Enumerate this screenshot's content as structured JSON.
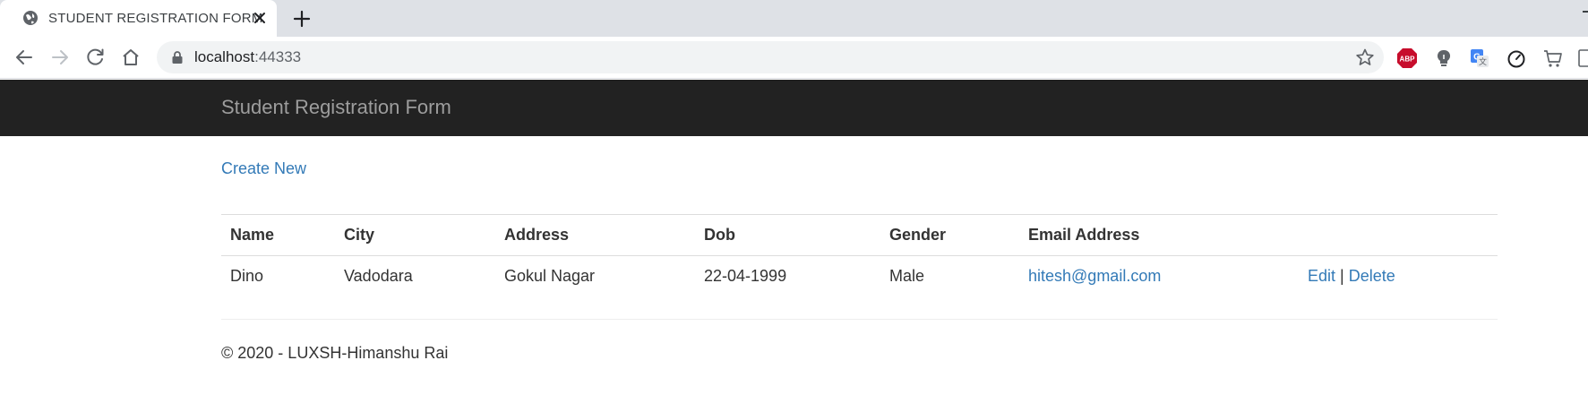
{
  "browser": {
    "tab_title": "STUDENT REGISTRATION FORM",
    "url_host": "localhost",
    "url_port": ":44333",
    "extensions": [
      "abp-icon",
      "lightbulb-icon",
      "translate-icon",
      "speedometer-icon",
      "cart-icon",
      "page-icon"
    ]
  },
  "navbar": {
    "brand": "Student Registration Form"
  },
  "actions": {
    "create_new": "Create New"
  },
  "table": {
    "headers": [
      "Name",
      "City",
      "Address",
      "Dob",
      "Gender",
      "Email Address"
    ],
    "rows": [
      {
        "name": "Dino",
        "city": "Vadodara",
        "address": "Gokul Nagar",
        "dob": "22-04-1999",
        "gender": "Male",
        "email": "hitesh@gmail.com",
        "edit": "Edit",
        "separator": "|",
        "delete": "Delete"
      }
    ]
  },
  "footer": {
    "text": "© 2020 - LUXSH-Himanshu Rai"
  },
  "colors": {
    "navbar_bg": "#222222",
    "brand_text": "#9d9d9d",
    "link": "#337ab7",
    "abp_red": "#c70d2c"
  }
}
